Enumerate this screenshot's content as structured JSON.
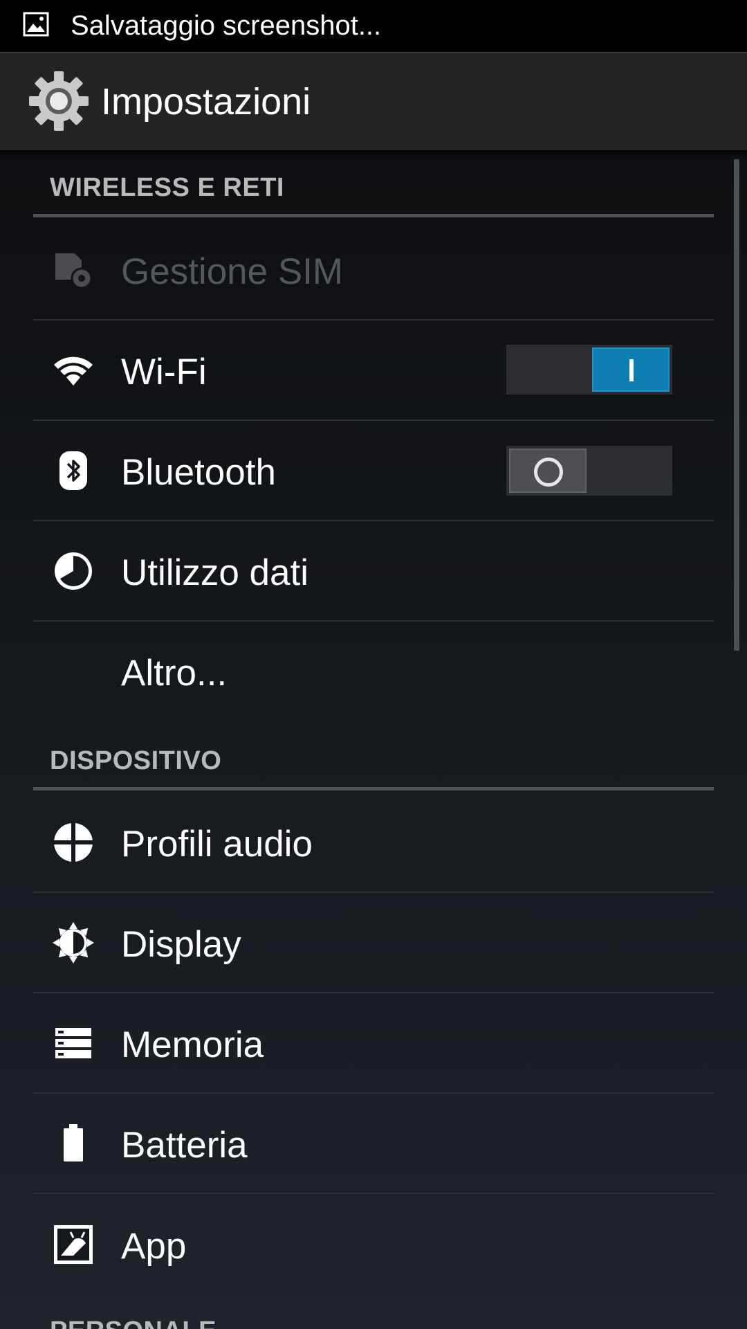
{
  "status_bar": {
    "notification_icon": "image-icon",
    "text": "Salvataggio screenshot..."
  },
  "action_bar": {
    "icon": "gear-icon",
    "title": "Impostazioni"
  },
  "sections": {
    "wireless": {
      "header": "WIRELESS E RETI",
      "items": [
        {
          "label": "Gestione SIM",
          "icon": "sim-management-icon",
          "enabled": false
        },
        {
          "label": "Wi-Fi",
          "icon": "wifi-icon",
          "toggle": "on"
        },
        {
          "label": "Bluetooth",
          "icon": "bluetooth-icon",
          "toggle": "off"
        },
        {
          "label": "Utilizzo dati",
          "icon": "data-usage-icon"
        },
        {
          "label": "Altro..."
        }
      ]
    },
    "device": {
      "header": "DISPOSITIVO",
      "items": [
        {
          "label": "Profili audio",
          "icon": "audio-profiles-icon"
        },
        {
          "label": "Display",
          "icon": "display-brightness-icon"
        },
        {
          "label": "Memoria",
          "icon": "storage-icon"
        },
        {
          "label": "Batteria",
          "icon": "battery-icon"
        },
        {
          "label": "App",
          "icon": "apps-icon"
        }
      ]
    },
    "personal": {
      "header": "PERSONALE"
    }
  },
  "colors": {
    "accent": "#0f7fb2",
    "status_bar": "#000000",
    "action_bar": "#222426",
    "header_text": "#b8b9ba",
    "disabled_text": "#55585b"
  }
}
